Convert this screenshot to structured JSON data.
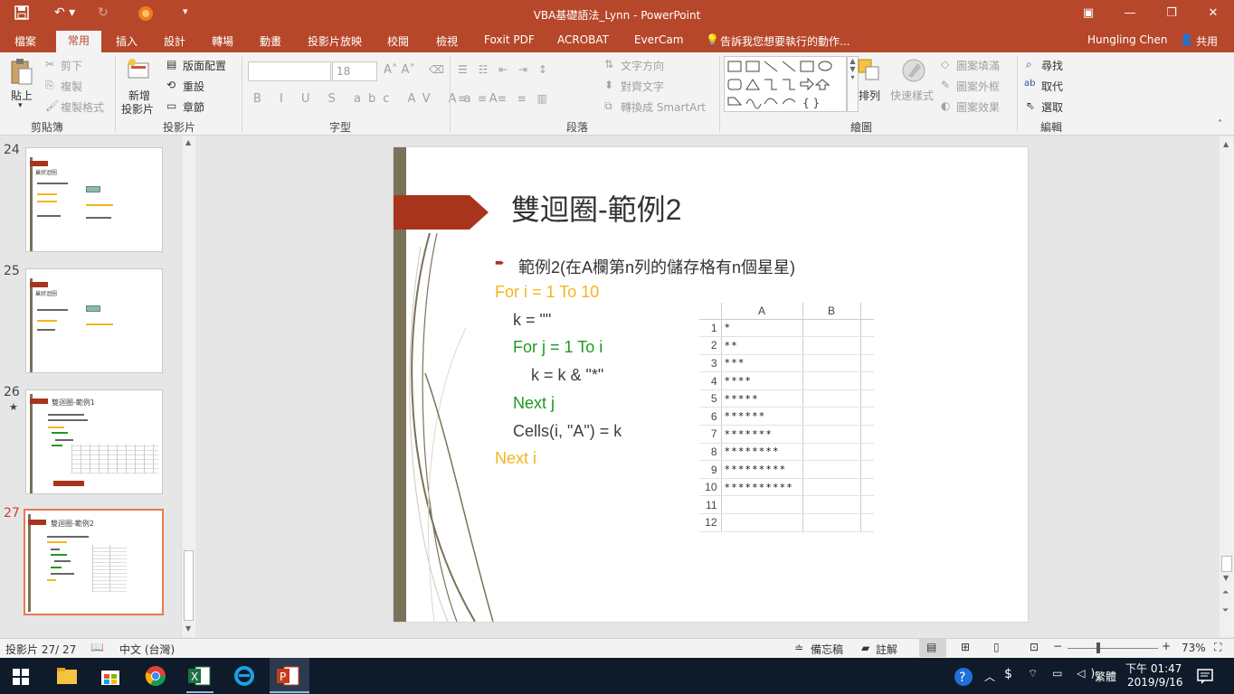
{
  "window": {
    "title": "VBA基礎語法_Lynn - PowerPoint"
  },
  "tabs": {
    "file": "檔案",
    "home": "常用",
    "insert": "插入",
    "design": "設計",
    "transitions": "轉場",
    "animations": "動畫",
    "slideshow": "投影片放映",
    "review": "校閱",
    "view": "檢視",
    "foxit": "Foxit PDF",
    "acrobat": "ACROBAT",
    "evercam": "EverCam",
    "tellme": "告訴我您想要執行的動作...",
    "user": "Hungling Chen",
    "share": "共用"
  },
  "ribbon": {
    "paste": "貼上",
    "cut": "剪下",
    "copy": "複製",
    "format_painter": "複製格式",
    "clipboard_group": "剪貼簿",
    "new_slide_1": "新增",
    "new_slide_2": "投影片",
    "layout": "版面配置",
    "reset": "重設",
    "section": "章節",
    "slides_group": "投影片",
    "font_size": "18",
    "font_group": "字型",
    "text_direction": "文字方向",
    "align_text": "對齊文字",
    "smartart": "轉換成 SmartArt",
    "paragraph_group": "段落",
    "arrange": "排列",
    "quick_styles": "快速樣式",
    "shape_fill": "圖案填滿",
    "shape_outline": "圖案外框",
    "shape_effects": "圖案效果",
    "drawing_group": "繪圖",
    "find": "尋找",
    "replace": "取代",
    "select": "選取",
    "editing_group": "編輯"
  },
  "thumbnails": [
    {
      "num": "24",
      "title": "巢狀迴圈",
      "star": ""
    },
    {
      "num": "25",
      "title": "巢狀迴圈",
      "star": ""
    },
    {
      "num": "26",
      "title": "雙迴圈-範例1",
      "star": "★"
    },
    {
      "num": "27",
      "title": "雙迴圈-範例2",
      "star": ""
    }
  ],
  "slide": {
    "title": "雙迴圈-範例2",
    "bullet": "範例2(在A欄第n列的儲存格有n個星星)",
    "code": [
      {
        "text": "For i = 1 To 10",
        "color": "#f5b51b"
      },
      {
        "text": "k = \"\"",
        "color": "#404040"
      },
      {
        "text": "For j = 1 To i",
        "color": "#1e9a1e"
      },
      {
        "text": "k = k & \"*\"",
        "color": "#404040"
      },
      {
        "text": "Next j",
        "color": "#1e9a1e"
      },
      {
        "text": "Cells(i, \"A\") = k",
        "color": "#404040"
      },
      {
        "text": "Next i",
        "color": "#f5b51b"
      }
    ],
    "sheet": {
      "col_a": "A",
      "col_b": "B",
      "rows": [
        {
          "n": "1",
          "a": "*"
        },
        {
          "n": "2",
          "a": "**"
        },
        {
          "n": "3",
          "a": "***"
        },
        {
          "n": "4",
          "a": "****"
        },
        {
          "n": "5",
          "a": "*****"
        },
        {
          "n": "6",
          "a": "******"
        },
        {
          "n": "7",
          "a": "*******"
        },
        {
          "n": "8",
          "a": "********"
        },
        {
          "n": "9",
          "a": "*********"
        },
        {
          "n": "10",
          "a": "**********"
        },
        {
          "n": "11",
          "a": ""
        },
        {
          "n": "12",
          "a": ""
        }
      ]
    }
  },
  "status": {
    "slide_count": "投影片 27/ 27",
    "language": "中文 (台灣)",
    "notes": "備忘稿",
    "comments": "註解",
    "zoom": "73%"
  },
  "taskbar": {
    "ime": "繁體",
    "time": "下午 01:47",
    "date": "2019/9/16"
  },
  "colors": {
    "accent": "#b7472a",
    "slide_bar": "#7a7259",
    "arrow": "#a8341c"
  }
}
